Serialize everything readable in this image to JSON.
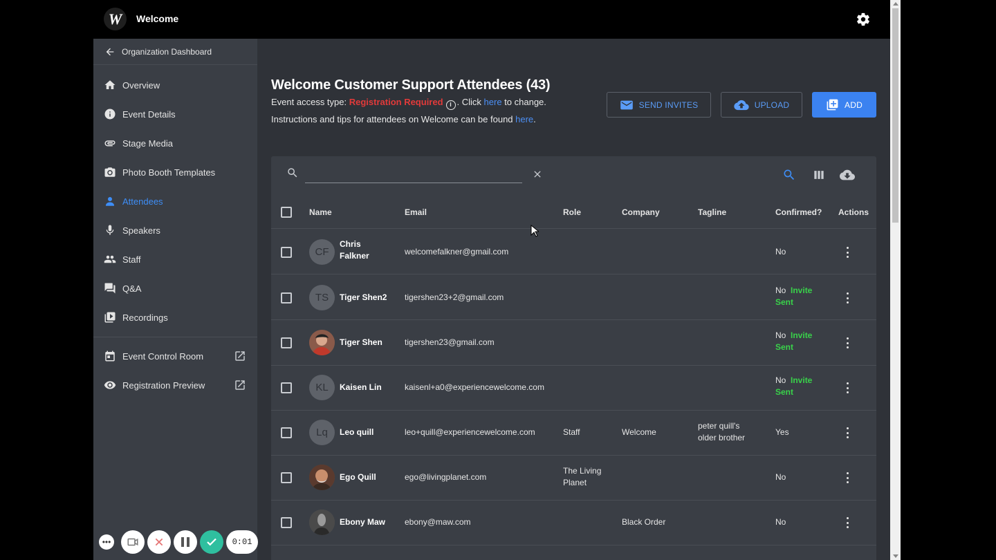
{
  "app": {
    "title": "Welcome",
    "logo_letter": "W"
  },
  "sidebar": {
    "back_label": "Organization Dashboard",
    "items": [
      {
        "label": "Overview",
        "icon": "home-icon"
      },
      {
        "label": "Event Details",
        "icon": "info-icon"
      },
      {
        "label": "Stage Media",
        "icon": "paperclip-icon"
      },
      {
        "label": "Photo Booth Templates",
        "icon": "camera-icon"
      },
      {
        "label": "Attendees",
        "icon": "person-icon",
        "active": true
      },
      {
        "label": "Speakers",
        "icon": "microphone-icon"
      },
      {
        "label": "Staff",
        "icon": "people-icon"
      },
      {
        "label": "Q&A",
        "icon": "chat-icon"
      },
      {
        "label": "Recordings",
        "icon": "video-library-icon"
      }
    ],
    "external_items": [
      {
        "label": "Event Control Room",
        "icon": "calendar-icon"
      },
      {
        "label": "Registration Preview",
        "icon": "eye-icon"
      }
    ]
  },
  "header": {
    "title": "Welcome Customer Support Attendees (43)",
    "access_prefix": "Event access type: ",
    "access_type": "Registration Required",
    "access_click": ". Click ",
    "access_link": "here",
    "access_suffix": " to change.",
    "instructions_prefix": "Instructions and tips for attendees on Welcome can be found ",
    "instructions_link": "here",
    "instructions_suffix": "."
  },
  "buttons": {
    "send_invites": "SEND INVITES",
    "upload": "UPLOAD",
    "add": "ADD"
  },
  "search": {
    "value": "",
    "placeholder": ""
  },
  "table": {
    "columns": {
      "name": "Name",
      "email": "Email",
      "role": "Role",
      "company": "Company",
      "tagline": "Tagline",
      "confirmed": "Confirmed?",
      "actions": "Actions"
    },
    "rows": [
      {
        "initials": "CF",
        "name_line1": "Chris",
        "name_line2": "Falkner",
        "email": "welcomefalkner@gmail.com",
        "role": "",
        "company": "",
        "tagline": "",
        "confirmed": "No",
        "invite": ""
      },
      {
        "initials": "TS",
        "name_line1": "Tiger Shen2",
        "name_line2": "",
        "email": "tigershen23+2@gmail.com",
        "role": "",
        "company": "",
        "tagline": "",
        "confirmed": "No",
        "invite": "Invite Sent"
      },
      {
        "initials": "",
        "name_line1": "Tiger Shen",
        "name_line2": "",
        "email": "tigershen23@gmail.com",
        "role": "",
        "company": "",
        "tagline": "",
        "confirmed": "No",
        "invite": "Invite Sent"
      },
      {
        "initials": "KL",
        "name_line1": "Kaisen Lin",
        "name_line2": "",
        "email": "kaisenl+a0@experiencewelcome.com",
        "role": "",
        "company": "",
        "tagline": "",
        "confirmed": "No",
        "invite": "Invite Sent"
      },
      {
        "initials": "Lq",
        "name_line1": "Leo quill",
        "name_line2": "",
        "email": "leo+quill@experiencewelcome.com",
        "role": "Staff",
        "company": "Welcome",
        "tagline": "peter quill's older brother",
        "confirmed": "Yes",
        "invite": ""
      },
      {
        "initials": "",
        "name_line1": "Ego Quill",
        "name_line2": "",
        "email": "ego@livingplanet.com",
        "role": "The Living Planet",
        "company": "",
        "tagline": "",
        "confirmed": "No",
        "invite": ""
      },
      {
        "initials": "",
        "name_line1": "Ebony Maw",
        "name_line2": "",
        "email": "ebony@maw.com",
        "role": "",
        "company": "Black Order",
        "tagline": "",
        "confirmed": "No",
        "invite": ""
      }
    ]
  },
  "recorder": {
    "timer": "0:01"
  },
  "colors": {
    "accent": "#3b82f0",
    "required": "#e23a3a",
    "invite_sent": "#39d24a",
    "sidebar_bg": "#3a3e45",
    "main_bg": "#2f3238"
  }
}
